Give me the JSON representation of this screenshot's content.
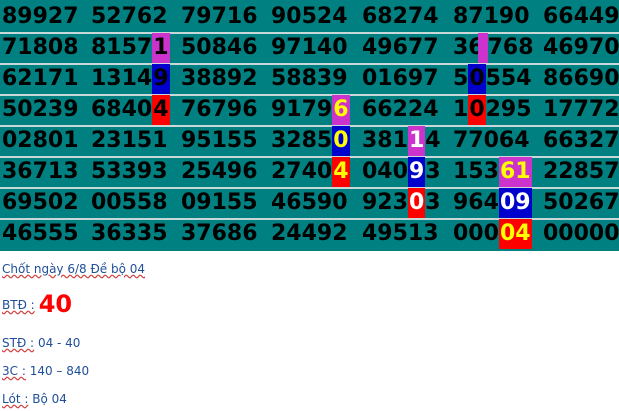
{
  "grid": {
    "rows": [
      [
        {
          "t": "89927"
        },
        {
          "t": "52762"
        },
        {
          "t": "79716"
        },
        {
          "t": "90524"
        },
        {
          "t": "68274"
        },
        {
          "t": "87190"
        },
        {
          "t": "66449"
        }
      ],
      [
        {
          "t": "71808"
        },
        {
          "t": "8157",
          "h": "1",
          "bg": "#cc33cc",
          "fg": "#000000"
        },
        {
          "t": "50846"
        },
        {
          "t": "97140"
        },
        {
          "t": "49677"
        },
        {
          "t": "36",
          "h": "",
          "bg": "#cc33cc",
          "fg": "#000000",
          "after": "768"
        },
        {
          "t": "46970"
        }
      ],
      [
        {
          "t": "62171"
        },
        {
          "t": "1314",
          "h": "9",
          "bg": "#0000cc",
          "fg": "#000000"
        },
        {
          "t": "38892"
        },
        {
          "t": "58839"
        },
        {
          "t": "01697"
        },
        {
          "t": "5",
          "h": "0",
          "bg": "#0000cc",
          "fg": "#000000",
          "after": "554"
        },
        {
          "t": "86690"
        }
      ],
      [
        {
          "t": "50239"
        },
        {
          "t": "6840",
          "h": "4",
          "bg": "#ff0000",
          "fg": "#000000"
        },
        {
          "t": "76796"
        },
        {
          "t": "9179",
          "h": "6",
          "bg": "#cc33cc",
          "fg": "#ffff00"
        },
        {
          "t": "66224"
        },
        {
          "t": "1",
          "h": "0",
          "bg": "#ff0000",
          "fg": "#000000",
          "after": "295"
        },
        {
          "t": "17772"
        }
      ],
      [
        {
          "t": "02801"
        },
        {
          "t": "23151"
        },
        {
          "t": "95155"
        },
        {
          "t": "3285",
          "h": "0",
          "bg": "#0000cc",
          "fg": "#ffff00"
        },
        {
          "t": "381",
          "h": "1",
          "bg": "#cc33cc",
          "fg": "#ffffff",
          "after": "4"
        },
        {
          "t": "77064"
        },
        {
          "t": "66327"
        }
      ],
      [
        {
          "t": "36713"
        },
        {
          "t": "53393"
        },
        {
          "t": "25496"
        },
        {
          "t": "2740",
          "h": "4",
          "bg": "#ff0000",
          "fg": "#ffff00"
        },
        {
          "t": "040",
          "h": "9",
          "bg": "#0000cc",
          "fg": "#ffffff",
          "after": "3"
        },
        {
          "t": "153",
          "h": "61",
          "bg": "#cc33cc",
          "fg": "#ffff00"
        },
        {
          "t": "22857"
        }
      ],
      [
        {
          "t": "69502"
        },
        {
          "t": "00558"
        },
        {
          "t": "09155"
        },
        {
          "t": "46590"
        },
        {
          "t": "923",
          "h": "0",
          "bg": "#ff0000",
          "fg": "#ffffff",
          "after": "3"
        },
        {
          "t": "964",
          "h": "09",
          "bg": "#0000cc",
          "fg": "#ffffff"
        },
        {
          "t": "50267"
        }
      ],
      [
        {
          "t": "46555"
        },
        {
          "t": "36335"
        },
        {
          "t": "37686"
        },
        {
          "t": "24492"
        },
        {
          "t": "49513"
        },
        {
          "t": "000",
          "h": "04",
          "bg": "#ff0000",
          "fg": "#ffff00"
        },
        {
          "t": "00000"
        }
      ]
    ]
  },
  "notes": {
    "line1": "Chốt ngày 6/8 Đề bộ 04",
    "btd_label": "BTĐ :",
    "btd_value": "40",
    "std_label": "STĐ :",
    "std_value": "04 - 40",
    "c3_label": "3C :",
    "c3_value": "140  – 840",
    "lot_label": "Lót :",
    "lot_value": "Bộ 04"
  },
  "colors": {
    "background": "#008080",
    "magenta": "#cc33cc",
    "blue": "#0000cc",
    "red": "#ff0000",
    "note_text": "#1f4e9a"
  }
}
